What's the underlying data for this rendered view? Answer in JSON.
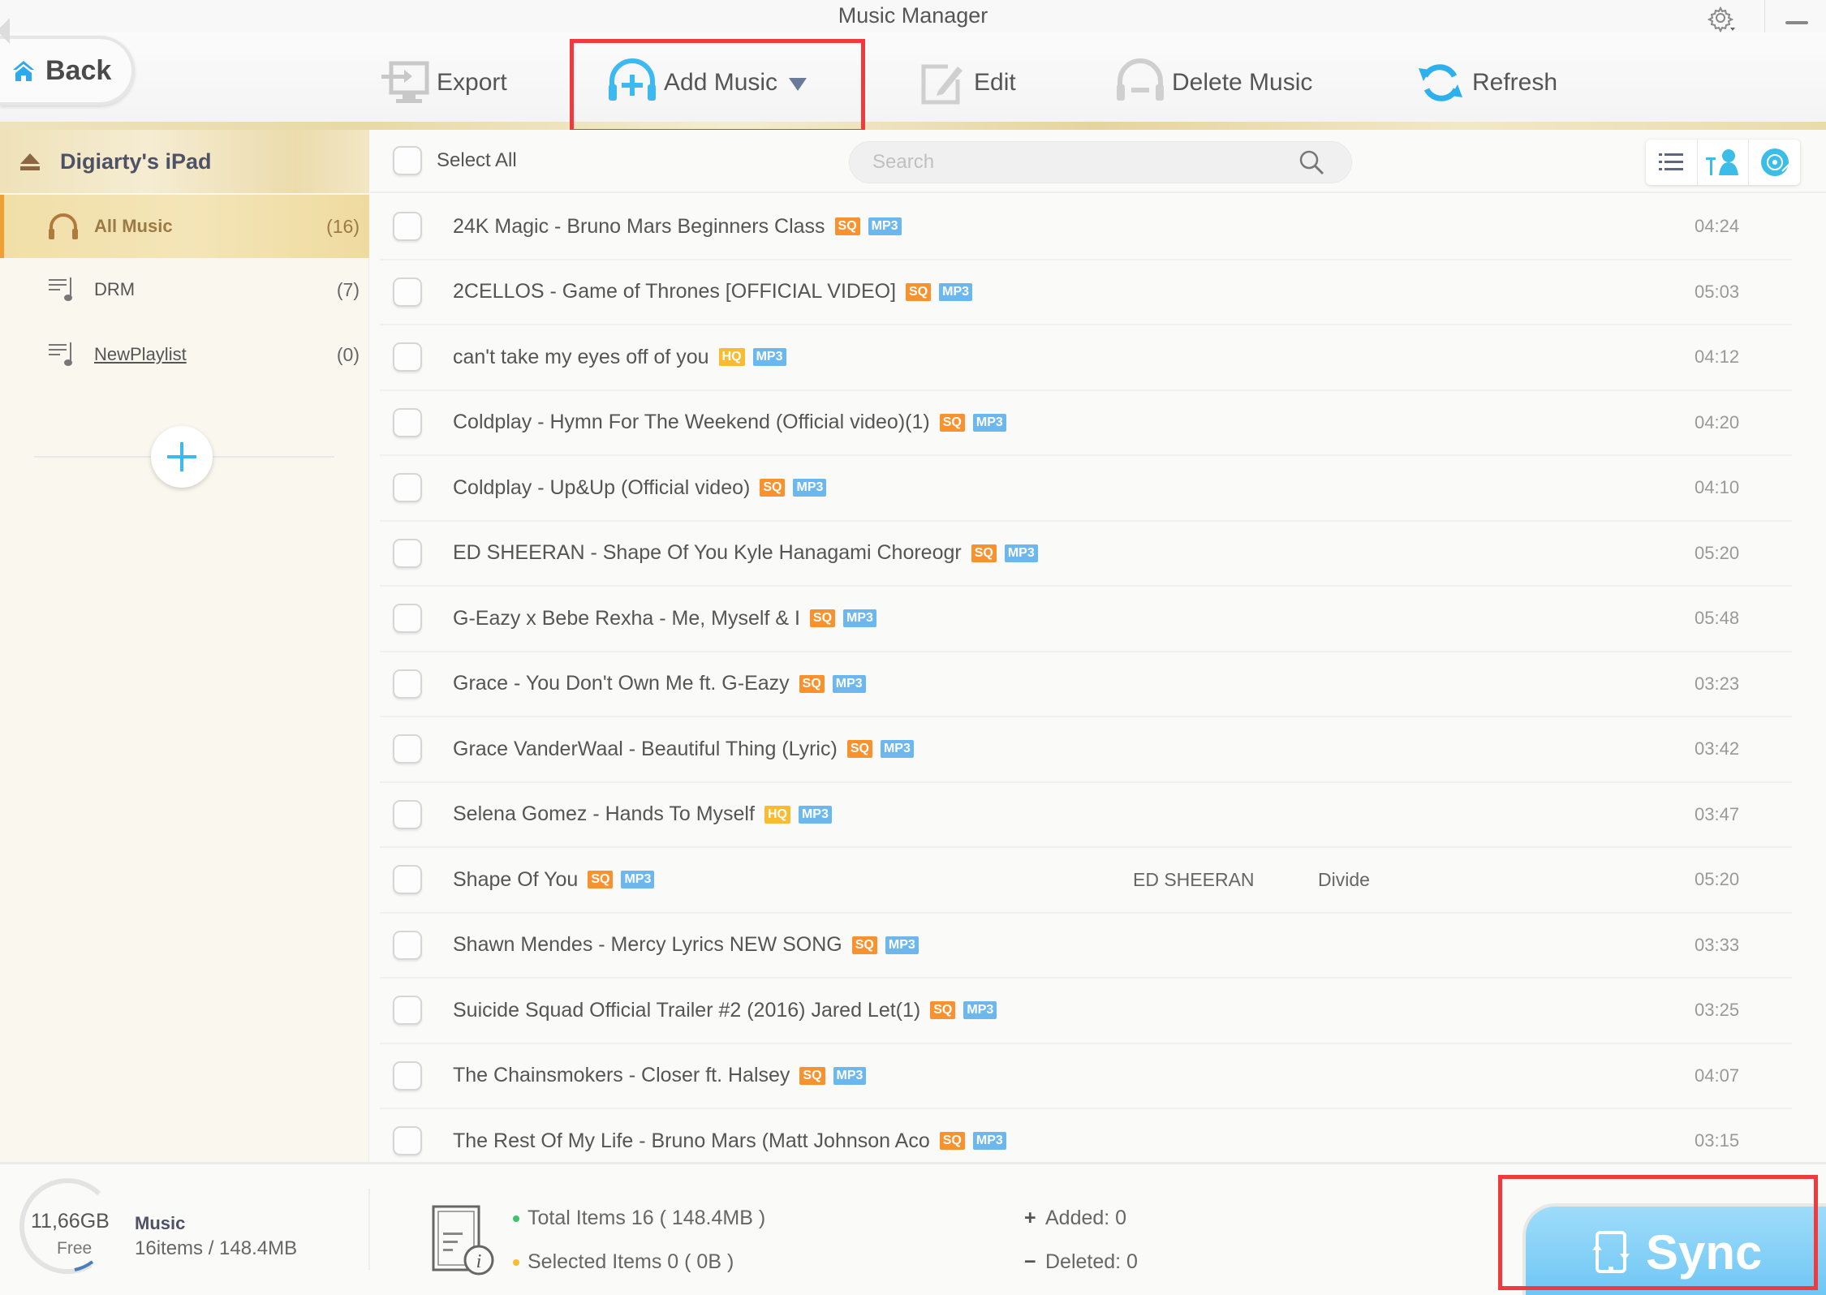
{
  "window": {
    "title": "Music Manager"
  },
  "toolbar": {
    "back_label": "Back",
    "export_label": "Export",
    "add_music_label": "Add Music",
    "edit_label": "Edit",
    "delete_label": "Delete Music",
    "refresh_label": "Refresh"
  },
  "sidebar": {
    "device_name": "Digiarty's iPad",
    "items": [
      {
        "label": "All Music",
        "count": "(16)",
        "icon": "headphones-icon",
        "active": true
      },
      {
        "label": "DRM",
        "count": "(7)",
        "icon": "playlist-icon",
        "active": false
      },
      {
        "label": "NewPlaylist",
        "count": "(0)",
        "icon": "playlist-icon",
        "active": false
      }
    ]
  },
  "list": {
    "select_all_label": "Select All",
    "search_placeholder": "Search",
    "view_modes": [
      "list-view-icon",
      "artist-view-icon",
      "album-view-icon"
    ],
    "tracks": [
      {
        "title": "24K Magic - Bruno Mars   Beginners Class",
        "quality": "SQ",
        "format": "MP3",
        "artist": "",
        "album": "",
        "duration": "04:24"
      },
      {
        "title": "2CELLOS - Game of Thrones [OFFICIAL VIDEO]",
        "quality": "SQ",
        "format": "MP3",
        "artist": "",
        "album": "",
        "duration": "05:03"
      },
      {
        "title": "can't take my eyes off of you",
        "quality": "HQ",
        "format": "MP3",
        "artist": "",
        "album": "",
        "duration": "04:12"
      },
      {
        "title": "Coldplay - Hymn For The Weekend (Official video)(1)",
        "quality": "SQ",
        "format": "MP3",
        "artist": "",
        "album": "",
        "duration": "04:20"
      },
      {
        "title": "Coldplay - Up&Up (Official video)",
        "quality": "SQ",
        "format": "MP3",
        "artist": "",
        "album": "",
        "duration": "04:10"
      },
      {
        "title": "ED SHEERAN - Shape Of You   Kyle Hanagami Choreogr",
        "quality": "SQ",
        "format": "MP3",
        "artist": "",
        "album": "",
        "duration": "05:20"
      },
      {
        "title": "G-Eazy x Bebe Rexha - Me, Myself & I",
        "quality": "SQ",
        "format": "MP3",
        "artist": "",
        "album": "",
        "duration": "05:48"
      },
      {
        "title": "Grace - You Don't Own Me ft. G-Eazy",
        "quality": "SQ",
        "format": "MP3",
        "artist": "",
        "album": "",
        "duration": "03:23"
      },
      {
        "title": "Grace VanderWaal - Beautiful Thing (Lyric)",
        "quality": "SQ",
        "format": "MP3",
        "artist": "",
        "album": "",
        "duration": "03:42"
      },
      {
        "title": "Selena Gomez - Hands To Myself",
        "quality": "HQ",
        "format": "MP3",
        "artist": "",
        "album": "",
        "duration": "03:47"
      },
      {
        "title": "Shape Of You",
        "quality": "SQ",
        "format": "MP3",
        "artist": "ED SHEERAN",
        "album": "Divide",
        "duration": "05:20"
      },
      {
        "title": "Shawn Mendes - Mercy Lyrics NEW SONG",
        "quality": "SQ",
        "format": "MP3",
        "artist": "",
        "album": "",
        "duration": "03:33"
      },
      {
        "title": "Suicide Squad Official Trailer #2 (2016) Jared Let(1)",
        "quality": "SQ",
        "format": "MP3",
        "artist": "",
        "album": "",
        "duration": "03:25"
      },
      {
        "title": "The Chainsmokers - Closer ft. Halsey",
        "quality": "SQ",
        "format": "MP3",
        "artist": "",
        "album": "",
        "duration": "04:07"
      },
      {
        "title": "The Rest Of My Life - Bruno Mars (Matt Johnson Aco",
        "quality": "SQ",
        "format": "MP3",
        "artist": "",
        "album": "",
        "duration": "03:15"
      }
    ]
  },
  "footer": {
    "free_space": "11,66GB",
    "free_label": "Free",
    "category": "Music",
    "category_detail": "16items / 148.4MB",
    "total_items": "Total Items 16 ( 148.4MB )",
    "selected_items": "Selected Items 0 ( 0B )",
    "added": "Added: 0",
    "deleted": "Deleted: 0",
    "sync_label": "Sync"
  },
  "colors": {
    "accent_blue": "#3bb9f0",
    "sq_badge": "#f7922f",
    "hq_badge": "#f8bb33",
    "mp3_badge": "#6cb8ee",
    "highlight_red": "#f03a3e",
    "total_dot": "#3cc46a",
    "selected_dot": "#f8bb33"
  }
}
